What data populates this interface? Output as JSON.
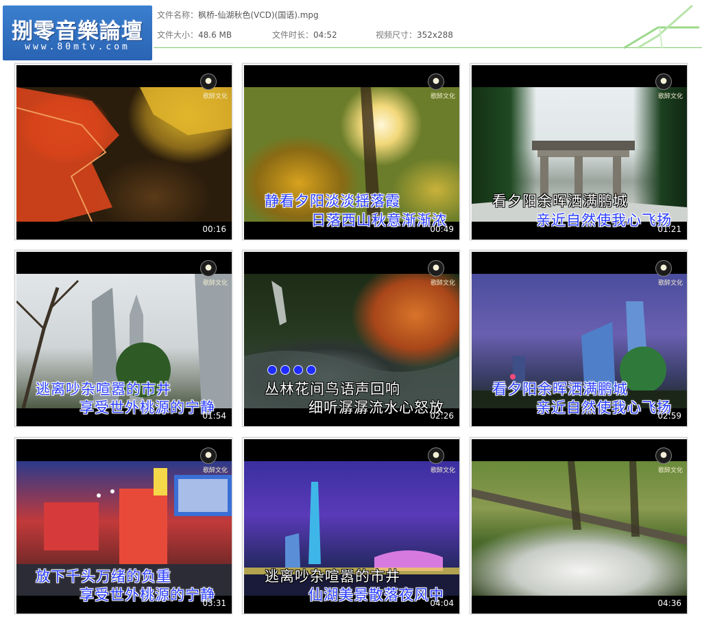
{
  "logo": {
    "title": "捌零音樂論壇",
    "url": "www.80mtv.com"
  },
  "file_info": {
    "name_label": "文件名称：",
    "name_value": "枫桥-仙湖秋色(VCD)(国语).mpg",
    "size_label": "文件大小：",
    "size_value": "48.6 MB",
    "duration_label": "文件时长：",
    "duration_value": "04:52",
    "dimension_label": "视频尺寸：",
    "dimension_value": "352x288"
  },
  "thumbnails": [
    {
      "time": "00:16",
      "line1": "",
      "line2": ""
    },
    {
      "time": "00:49",
      "line1": "静看夕阳淡淡揺落霞",
      "line2": "日落西山秋意渐渐浓"
    },
    {
      "time": "01:21",
      "line1": "看夕阳余晖洒满鹏城",
      "line2": "亲近自然使我心飞扬"
    },
    {
      "time": "01:54",
      "line1": "逃离吵杂喧嚣的市井",
      "line2": "享受世外桃源的宁静"
    },
    {
      "time": "02:26",
      "line1": "丛林花间鸟语声回响",
      "line2": "细听潺潺流水心怒放"
    },
    {
      "time": "02:59",
      "line1": "看夕阳余晖洒满鹏城",
      "line2": "亲近自然使我心飞扬"
    },
    {
      "time": "03:31",
      "line1": "放下千头万绪的负重",
      "line2": "享受世外桃源的宁静"
    },
    {
      "time": "04:04",
      "line1": "逃离吵杂喧嚣的市井",
      "line2": "仙湖美景散落夜风中"
    },
    {
      "time": "04:36",
      "line1": "",
      "line2": ""
    }
  ],
  "watermark": "歌醉文化",
  "colors": {
    "logo_bg": "#2f6fc0",
    "lyric_blue": "#2a3dff",
    "header_line": "#7cc96a"
  }
}
